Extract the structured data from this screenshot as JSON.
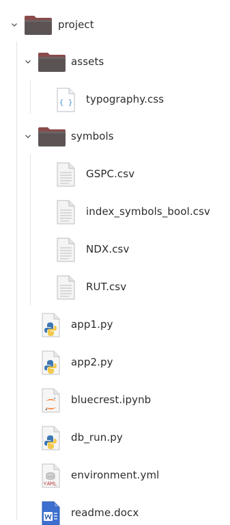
{
  "tree": {
    "root": {
      "name": "project"
    },
    "assets": {
      "name": "assets"
    },
    "typography": {
      "name": "typography.css"
    },
    "symbols": {
      "name": "symbols"
    },
    "gspc": {
      "name": "GSPC.csv"
    },
    "index_bool": {
      "name": "index_symbols_bool.csv"
    },
    "ndx": {
      "name": "NDX.csv"
    },
    "rut": {
      "name": "RUT.csv"
    },
    "app1": {
      "name": "app1.py"
    },
    "app2": {
      "name": "app2.py"
    },
    "bluecrest": {
      "name": "bluecrest.ipynb"
    },
    "db_run": {
      "name": "db_run.py"
    },
    "environment": {
      "name": "environment.yml"
    },
    "readme": {
      "name": "readme.docx"
    }
  },
  "colors": {
    "folder": "#5a4e4e",
    "folder_tab": "#8a4a4a",
    "python_blue": "#3e78b2",
    "python_yellow": "#f2c94c",
    "jupyter_orange": "#f37726",
    "word_blue": "#2b5cb5",
    "css_blue": "#4a8fd8"
  }
}
